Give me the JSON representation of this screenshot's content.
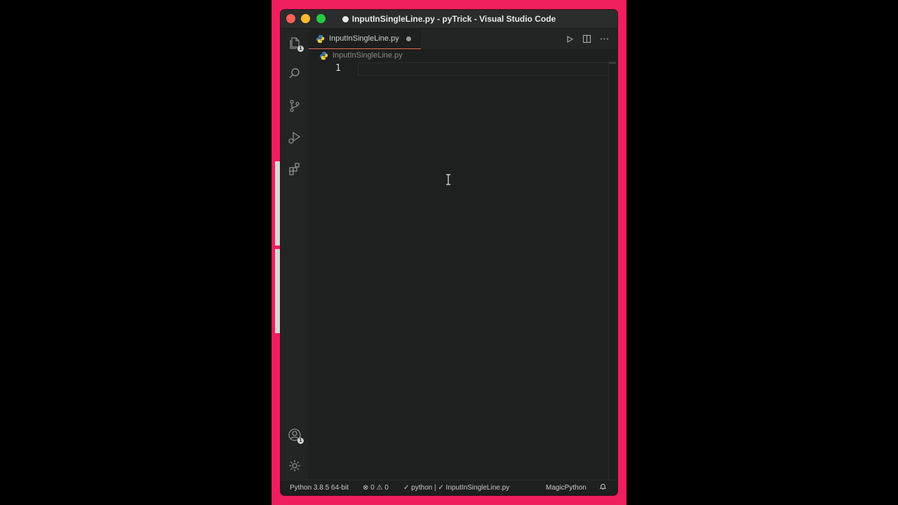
{
  "window": {
    "title": "InputInSingleLine.py - pyTrick - Visual Studio Code"
  },
  "activity_bar": {
    "icons": [
      "files-icon",
      "search-icon",
      "source-control-icon",
      "run-debug-icon",
      "extensions-icon",
      "account-icon",
      "gear-icon"
    ],
    "explorer_badge": "1",
    "account_badge": "1"
  },
  "tabs": [
    {
      "label": "InputInSingleLine.py",
      "modified": true,
      "active": true
    }
  ],
  "breadcrumb": {
    "file": "InputInSingleLine.py"
  },
  "editor": {
    "line_numbers": [
      "1"
    ],
    "content": [
      ""
    ]
  },
  "statusbar": {
    "interpreter": "Python 3.8.5 64-bit",
    "errors": "0",
    "warnings": "0",
    "python_check": "python",
    "separator": "|",
    "file_check": "InputInSingleLine.py",
    "theme": "MagicPython"
  },
  "colors": {
    "frame": "#ef1f5c",
    "editor_bg": "#1e1f1f",
    "tab_underline": "#e06a4f"
  }
}
